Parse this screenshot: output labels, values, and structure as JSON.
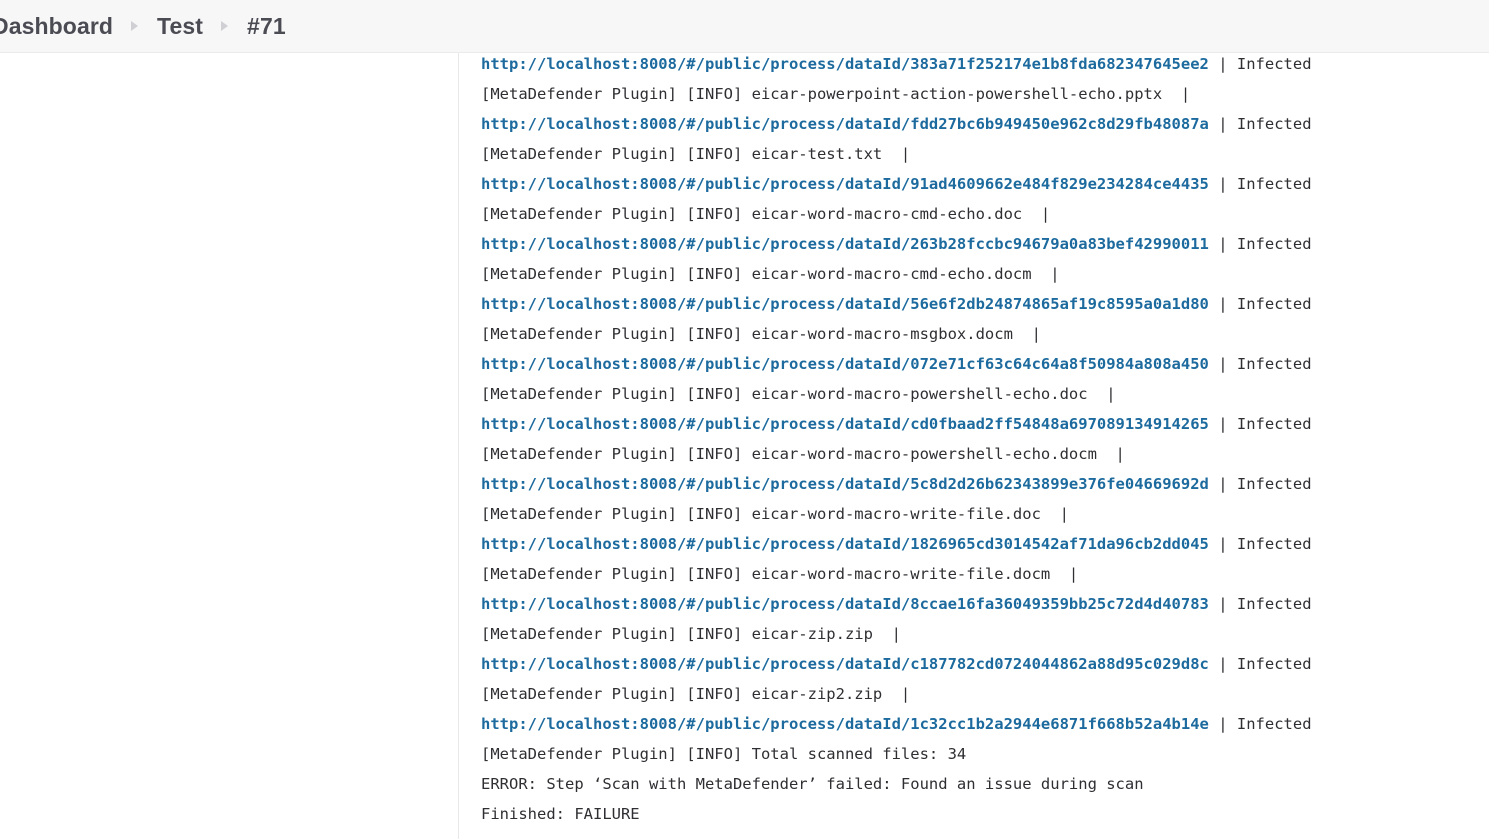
{
  "breadcrumb": {
    "items": [
      {
        "label": "Dashboard",
        "current": false
      },
      {
        "label": "Test",
        "current": false
      },
      {
        "label": "#71",
        "current": true
      }
    ],
    "separator_icon": "chevron-right-icon"
  },
  "colors": {
    "link": "#1c6a9e",
    "text": "#2f2f33",
    "header_bg": "#f7f7f8",
    "divider": "#e8e8ea",
    "breadcrumb_text": "#4b4b54",
    "separator": "#cfcfd4"
  },
  "console": {
    "url_prefix": "http://localhost:8008/#/public/process/dataId/",
    "status_suffix": " | Infected",
    "entries": [
      {
        "data_id": "383a71f252174e1b8fda682347645ee2",
        "file_line": "[MetaDefender Plugin] [INFO] eicar-powerpoint-action-powershell-echo.pptx  |"
      },
      {
        "data_id": "fdd27bc6b949450e962c8d29fb48087a",
        "file_line": "[MetaDefender Plugin] [INFO] eicar-test.txt  |"
      },
      {
        "data_id": "91ad4609662e484f829e234284ce4435",
        "file_line": "[MetaDefender Plugin] [INFO] eicar-word-macro-cmd-echo.doc  |"
      },
      {
        "data_id": "263b28fccbc94679a0a83bef42990011",
        "file_line": "[MetaDefender Plugin] [INFO] eicar-word-macro-cmd-echo.docm  |"
      },
      {
        "data_id": "56e6f2db24874865af19c8595a0a1d80",
        "file_line": "[MetaDefender Plugin] [INFO] eicar-word-macro-msgbox.docm  |"
      },
      {
        "data_id": "072e71cf63c64c64a8f50984a808a450",
        "file_line": "[MetaDefender Plugin] [INFO] eicar-word-macro-powershell-echo.doc  |"
      },
      {
        "data_id": "cd0fbaad2ff54848a697089134914265",
        "file_line": "[MetaDefender Plugin] [INFO] eicar-word-macro-powershell-echo.docm  |"
      },
      {
        "data_id": "5c8d2d26b62343899e376fe04669692d",
        "file_line": "[MetaDefender Plugin] [INFO] eicar-word-macro-write-file.doc  |"
      },
      {
        "data_id": "1826965cd3014542af71da96cb2dd045",
        "file_line": "[MetaDefender Plugin] [INFO] eicar-word-macro-write-file.docm  |"
      },
      {
        "data_id": "8ccae16fa36049359bb25c72d4d40783",
        "file_line": "[MetaDefender Plugin] [INFO] eicar-zip.zip  |"
      },
      {
        "data_id": "c187782cd0724044862a88d95c029d8c",
        "file_line": "[MetaDefender Plugin] [INFO] eicar-zip2.zip  |"
      },
      {
        "data_id": "1c32cc1b2a2944e6871f668b52a4b14e",
        "file_line": null
      }
    ],
    "tail_lines": [
      "[MetaDefender Plugin] [INFO] Total scanned files: 34",
      "ERROR: Step ‘Scan with MetaDefender’ failed: Found an issue during scan",
      "Finished: FAILURE"
    ]
  }
}
